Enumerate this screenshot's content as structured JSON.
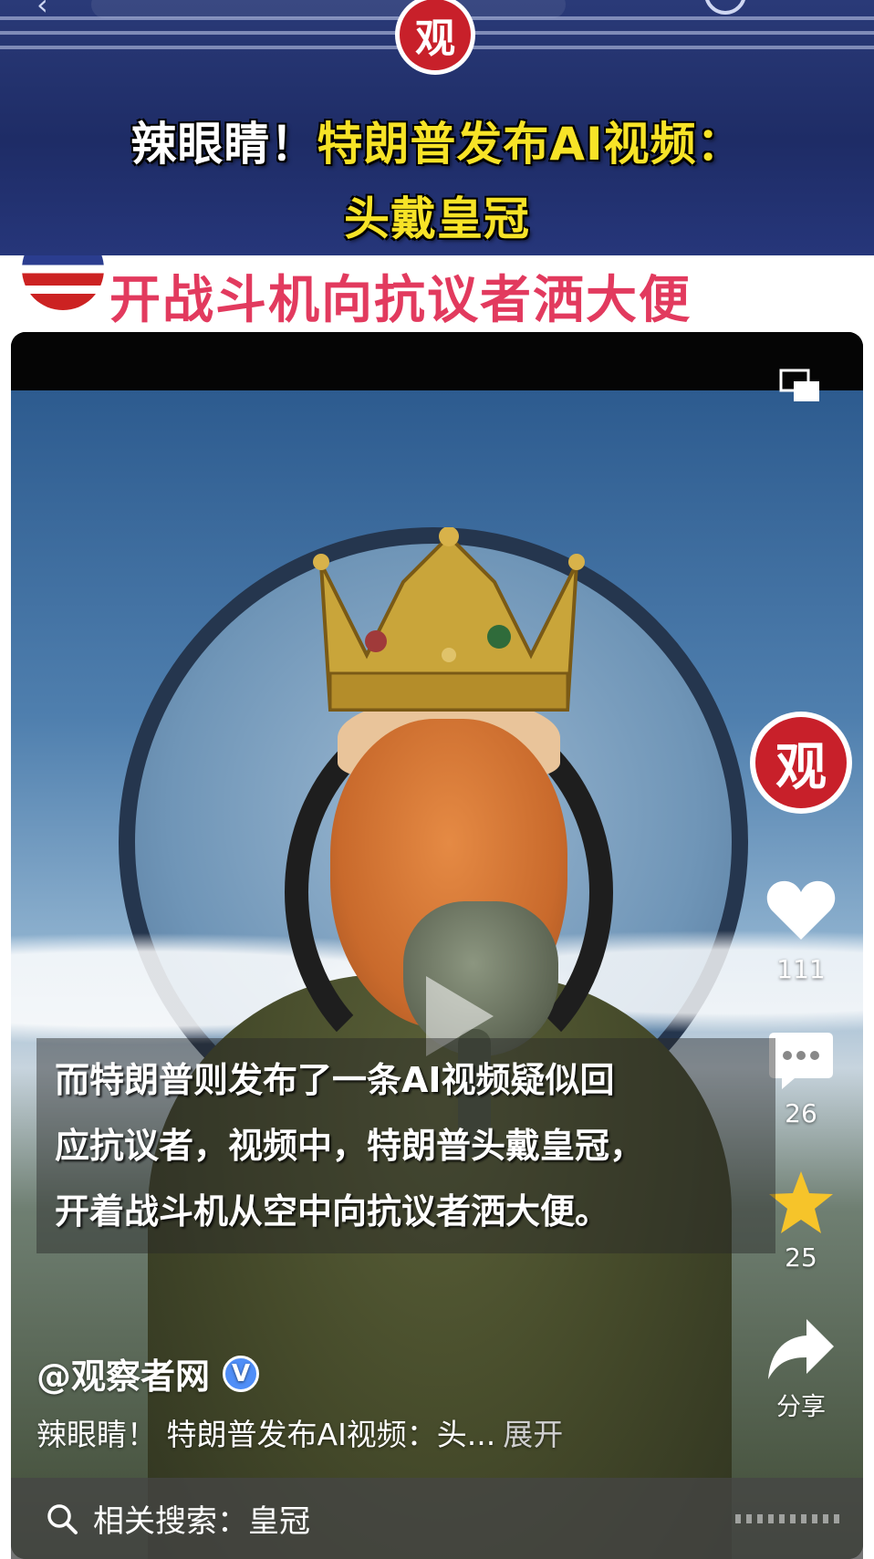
{
  "banner": {
    "logo_char": "观",
    "headline_white": "辣眼睛！",
    "headline_yellow_line1": "特朗普发布AI视频：",
    "headline_yellow_line2": "头戴皇冠"
  },
  "subtitle": "开战斗机向抗议者洒大便",
  "video": {
    "caption": "而特朗普则发布了一条AI视频疑似回应抗议者，视频中，特朗普头戴皇冠，开着战斗机从空中向抗议者洒大便。",
    "caption_lines": [
      "而特朗普则发布了一条AI视频疑似回",
      "应抗议者，视频中，特朗普头戴皇冠，",
      "开着战斗机从空中向抗议者洒大便。"
    ],
    "author": "@观察者网",
    "verified_mark": "V",
    "description": "辣眼睛！ 特朗普发布AI视频：头...",
    "expand_label": "展开"
  },
  "rail": {
    "logo_char": "观",
    "likes": "111",
    "comments": "26",
    "favorites": "25",
    "share_label": "分享"
  },
  "search": {
    "label": "相关搜索：皇冠"
  },
  "colors": {
    "banner_bg": "#1e2c66",
    "headline_yellow": "#f7e327",
    "subtitle_red": "#e23a5e",
    "logo_red": "#c8202a",
    "star_yellow": "#f6c42a",
    "verified_blue": "#4f8ef7"
  }
}
